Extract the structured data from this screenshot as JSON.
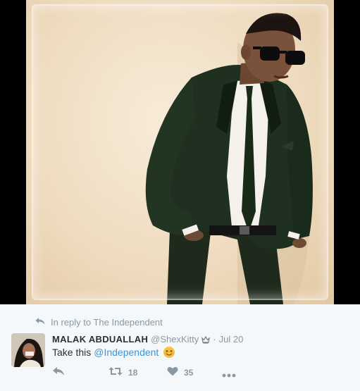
{
  "tweet": {
    "reply_context": "In reply to The Independent",
    "author_name": "MALAK ABDUALLAH",
    "author_handle": "@ShexKitty",
    "separator": "·",
    "date": "Jul 20",
    "text": "Take this",
    "mention": "@Independent",
    "retweet_count": "18",
    "like_count": "35"
  },
  "icons": {
    "reply": "reply-arrow-icon",
    "retweet": "retweet-icon",
    "like": "heart-icon",
    "more": "more-dots-icon",
    "crown": "crown-icon",
    "emoji": "smiling-face-emoji"
  },
  "colors": {
    "link": "#3b94d9",
    "muted": "#8899a6",
    "text": "#292f33",
    "background": "#f5f8fa"
  }
}
